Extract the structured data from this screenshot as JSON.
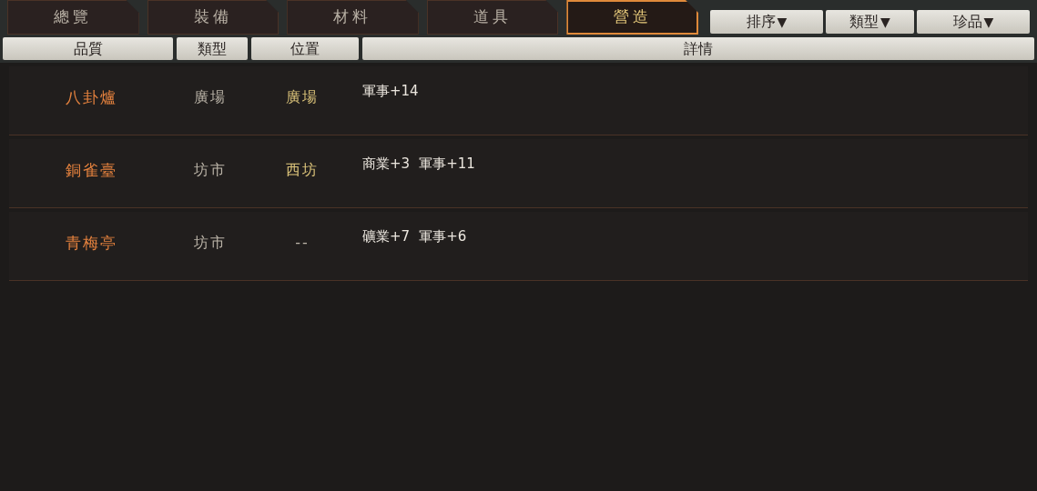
{
  "tabs": [
    {
      "label": "總覽",
      "selected": false
    },
    {
      "label": "裝備",
      "selected": false
    },
    {
      "label": "材料",
      "selected": false
    },
    {
      "label": "道具",
      "selected": false
    },
    {
      "label": "營造",
      "selected": true
    }
  ],
  "filters": [
    {
      "label": "排序",
      "arrow": "▼"
    },
    {
      "label": "類型",
      "arrow": "▼"
    },
    {
      "label": "珍品",
      "arrow": "▼"
    }
  ],
  "table": {
    "columns": [
      "品質",
      "類型",
      "位置",
      "詳情"
    ],
    "rows": [
      {
        "name": "八卦爐",
        "type": "廣場",
        "location": "廣場",
        "location_set": true,
        "details": [
          "軍事+14"
        ]
      },
      {
        "name": "銅雀臺",
        "type": "坊市",
        "location": "西坊",
        "location_set": true,
        "details": [
          "商業+3",
          "軍事+11"
        ]
      },
      {
        "name": "青梅亭",
        "type": "坊市",
        "location": "--",
        "location_set": false,
        "details": [
          "礦業+7",
          "軍事+6"
        ]
      }
    ]
  }
}
